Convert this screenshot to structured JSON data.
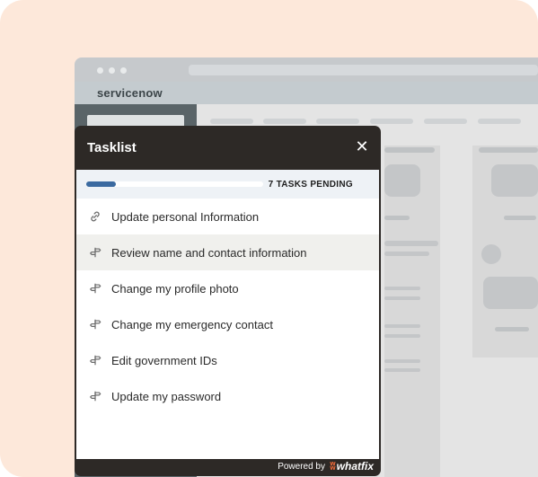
{
  "app": {
    "logo_text": "servicenow"
  },
  "tasklist": {
    "title": "Tasklist",
    "close_icon": "close-icon",
    "progress_fraction": 0.17,
    "pending_label": "7 TASKS PENDING",
    "tasks": [
      {
        "label": "Update personal Information",
        "icon": "link-icon",
        "active": false
      },
      {
        "label": "Review name and contact information",
        "icon": "signpost-icon",
        "active": true
      },
      {
        "label": "Change my profile photo",
        "icon": "signpost-icon",
        "active": false
      },
      {
        "label": "Change my emergency contact",
        "icon": "signpost-icon",
        "active": false
      },
      {
        "label": "Edit government IDs",
        "icon": "signpost-icon",
        "active": false
      },
      {
        "label": "Update my password",
        "icon": "signpost-icon",
        "active": false
      }
    ]
  },
  "footer": {
    "powered_by": "Powered by",
    "brand": "whatfix"
  },
  "colors": {
    "accent": "#3b6aa0",
    "panel_bg": "#2d2926",
    "brand": "#f26b3a",
    "page_bg": "#fde8da"
  }
}
